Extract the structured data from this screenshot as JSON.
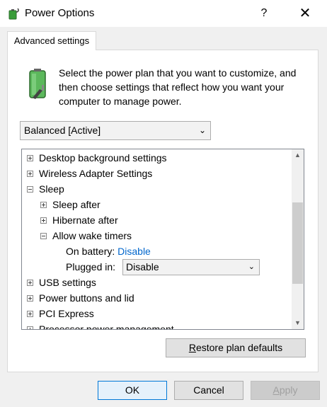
{
  "window": {
    "title": "Power Options",
    "help_label": "?",
    "close_label": "✕"
  },
  "tab": {
    "label": "Advanced settings"
  },
  "description": "Select the power plan that you want to customize, and then choose settings that reflect how you want your computer to manage power.",
  "plan_select": {
    "value": "Balanced [Active]"
  },
  "tree": {
    "items": [
      {
        "label": "Desktop background settings",
        "expander": "plus"
      },
      {
        "label": "Wireless Adapter Settings",
        "expander": "plus"
      },
      {
        "label": "Sleep",
        "expander": "minus"
      },
      {
        "label": "Sleep after",
        "expander": "plus"
      },
      {
        "label": "Hibernate after",
        "expander": "plus"
      },
      {
        "label": "Allow wake timers",
        "expander": "minus"
      },
      {
        "label": "USB settings",
        "expander": "plus"
      },
      {
        "label": "Power buttons and lid",
        "expander": "plus"
      },
      {
        "label": "PCI Express",
        "expander": "plus"
      },
      {
        "label": "Processor power management",
        "expander": "plus"
      }
    ],
    "on_battery_label": "On battery:",
    "on_battery_value": "Disable",
    "plugged_in_label": "Plugged in:",
    "plugged_in_value": "Disable"
  },
  "buttons": {
    "restore_prefix": "R",
    "restore_rest": "estore plan defaults",
    "ok": "OK",
    "cancel": "Cancel",
    "apply_prefix": "A",
    "apply_rest": "pply"
  }
}
